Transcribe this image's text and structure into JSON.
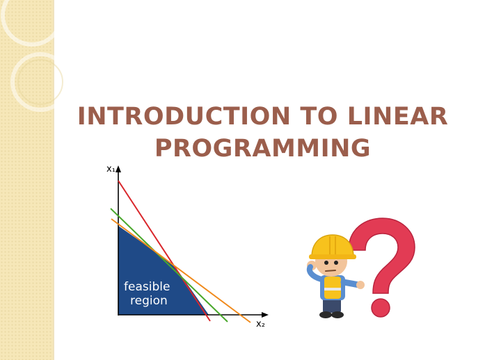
{
  "slide": {
    "title_line1": "INTRODUCTION TO LINEAR",
    "title_line2": "PROGRAMMING"
  },
  "graph": {
    "y_axis_label": "x₁",
    "x_axis_label": "x₂",
    "region_label_line1": "feasible",
    "region_label_line2": "region",
    "colors": {
      "region": "#1f4a87",
      "line_red": "#d9262b",
      "line_green": "#4aa82c",
      "line_orange": "#f08a1c"
    }
  },
  "illustration": {
    "icon": "worker-with-question-mark-icon",
    "colors": {
      "helmet": "#f7c21d",
      "question_mark": "#e23b54",
      "shirt": "#5a8ed0"
    }
  }
}
